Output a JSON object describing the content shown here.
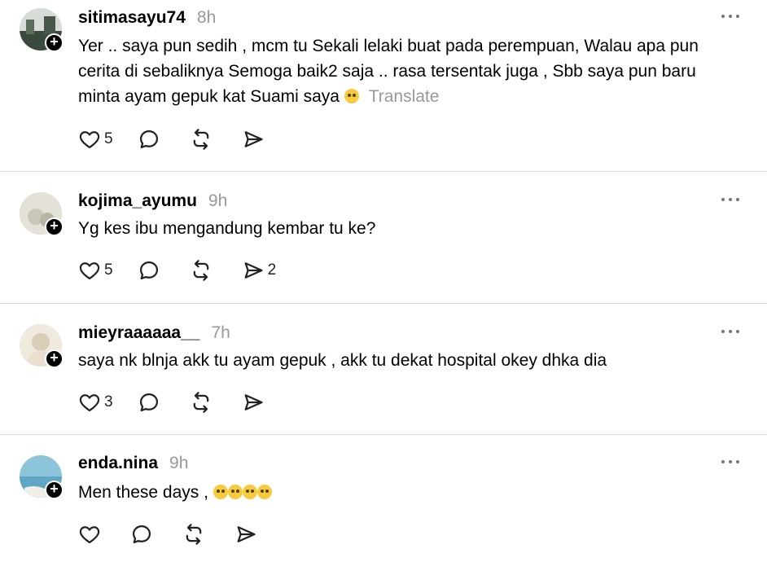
{
  "posts": [
    {
      "username": "sitimasayu74",
      "time": "8h",
      "text": "Yer .. saya pun sedih , mcm tu Sekali lelaki buat pada perempuan, Walau apa pun cerita di sebaliknya Semoga baik2 saja .. rasa tersentak juga , Sbb saya pun baru minta ayam gepuk kat Suami saya",
      "translate": "Translate",
      "likes": "5",
      "shares": "",
      "avatar_color": "#3a4a3c"
    },
    {
      "username": "kojima_ayumu",
      "time": "9h",
      "text": "Yg kes ibu mengandung kembar tu ke?",
      "likes": "5",
      "shares": "2",
      "avatar_color": "#c9c7b9"
    },
    {
      "username": "mieyraaaaaa__",
      "time": "7h",
      "text": "saya nk blnja akk tu ayam gepuk , akk tu dekat hospital okey dhka dia",
      "likes": "3",
      "shares": "",
      "avatar_color": "#d9cdb8"
    },
    {
      "username": "enda.nina",
      "time": "9h",
      "text": "Men these days ,",
      "likes": "",
      "shares": "",
      "avatar_color": "#5fa7c4"
    }
  ],
  "icons": {
    "like": "heart-icon",
    "comment": "comment-icon",
    "repost": "repost-icon",
    "share": "share-icon",
    "more": "more-icon",
    "follow": "plus-icon"
  }
}
